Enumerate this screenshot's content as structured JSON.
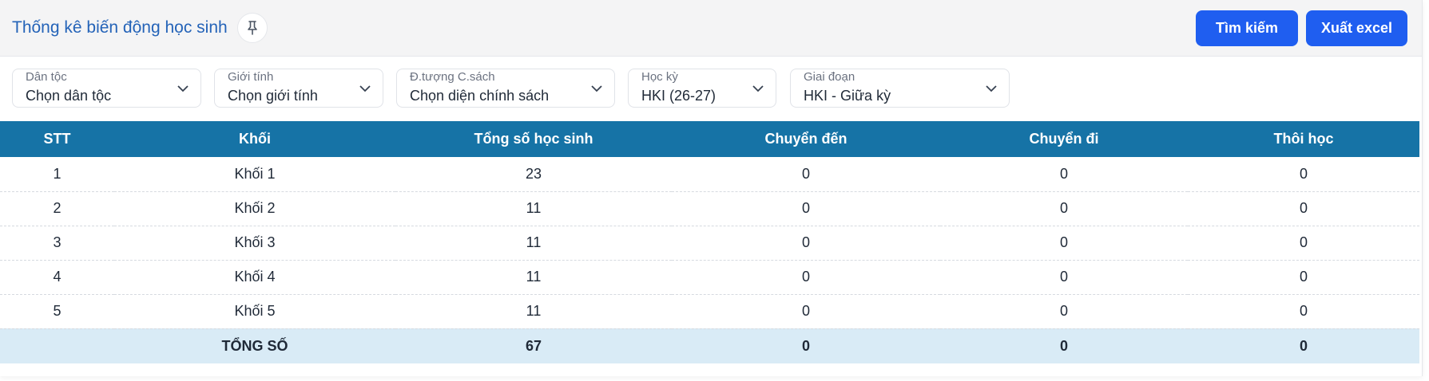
{
  "header": {
    "title": "Thống kê biến động học sinh",
    "search_label": "Tìm kiếm",
    "export_label": "Xuất excel"
  },
  "filters": [
    {
      "label": "Dân tộc",
      "value": "Chọn dân tộc"
    },
    {
      "label": "Giới tính",
      "value": "Chọn giới tính"
    },
    {
      "label": "Đ.tượng C.sách",
      "value": "Chọn diện chính sách"
    },
    {
      "label": "Học kỳ",
      "value": "HKI (26-27)"
    },
    {
      "label": "Giai đoạn",
      "value": "HKI - Giữa kỳ"
    }
  ],
  "table": {
    "columns": [
      "STT",
      "Khối",
      "Tổng số học sinh",
      "Chuyển đến",
      "Chuyển đi",
      "Thôi học"
    ],
    "rows": [
      [
        "1",
        "Khối 1",
        "23",
        "0",
        "0",
        "0"
      ],
      [
        "2",
        "Khối 2",
        "11",
        "0",
        "0",
        "0"
      ],
      [
        "3",
        "Khối 3",
        "11",
        "0",
        "0",
        "0"
      ],
      [
        "4",
        "Khối 4",
        "11",
        "0",
        "0",
        "0"
      ],
      [
        "5",
        "Khối 5",
        "11",
        "0",
        "0",
        "0"
      ]
    ],
    "total": [
      "",
      "TỔNG SỐ",
      "67",
      "0",
      "0",
      "0"
    ]
  },
  "icons": {
    "pin": "pin-icon",
    "dropdown": "chevron-down-icon"
  },
  "colors": {
    "title": "#2463b8",
    "button": "#1f5ef0",
    "table_header": "#1673a6",
    "total_row": "#d9ebf6"
  }
}
